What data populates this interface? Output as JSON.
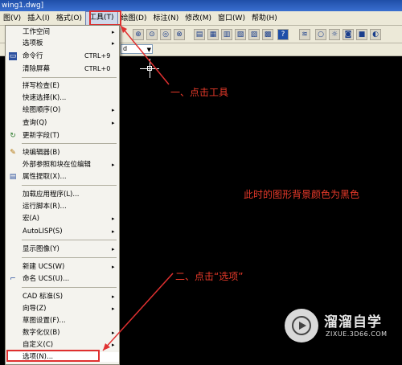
{
  "window": {
    "title": "wing1.dwg]"
  },
  "menubar": {
    "items": [
      "图(V)",
      "插入(I)",
      "格式(O)",
      "工具(T)",
      "绘图(D)",
      "标注(N)",
      "修改(M)",
      "窗口(W)",
      "帮助(H)"
    ]
  },
  "toolbar": {
    "combo_value": "d",
    "help_glyph": "?"
  },
  "menu": {
    "items": [
      {
        "label": "工作空间",
        "arrow": "▸"
      },
      {
        "label": "选项板",
        "arrow": "▸"
      },
      {
        "label": "命令行",
        "shortcut": "CTRL+9"
      },
      {
        "label": "清除屏幕",
        "shortcut": "CTRL+0"
      },
      {
        "label": "拼写检查(E)"
      },
      {
        "label": "快速选择(K)..."
      },
      {
        "label": "绘图顺序(O)",
        "arrow": "▸"
      },
      {
        "label": "查询(Q)",
        "arrow": "▸"
      },
      {
        "label": "更新字段(T)"
      },
      {
        "label": "块编辑器(B)"
      },
      {
        "label": "外部参照和块在位编辑",
        "arrow": "▸"
      },
      {
        "label": "属性提取(X)..."
      },
      {
        "label": "加载应用程序(L)..."
      },
      {
        "label": "运行脚本(R)..."
      },
      {
        "label": "宏(A)",
        "arrow": "▸"
      },
      {
        "label": "AutoLISP(S)",
        "arrow": "▸"
      },
      {
        "label": "显示图像(Y)",
        "arrow": "▸"
      },
      {
        "label": "新建 UCS(W)",
        "arrow": "▸"
      },
      {
        "label": "命名 UCS(U)..."
      },
      {
        "label": "CAD 标准(S)",
        "arrow": "▸"
      },
      {
        "label": "向导(Z)",
        "arrow": "▸"
      },
      {
        "label": "草图设置(F)..."
      },
      {
        "label": "数字化仪(B)",
        "arrow": "▸"
      },
      {
        "label": "自定义(C)",
        "arrow": "▸"
      },
      {
        "label": "选项(N)..."
      }
    ]
  },
  "annotations": {
    "step1": "一、点击工具",
    "step2": "二、点击“选项”",
    "note": "此时的图形背景颜色为黑色"
  },
  "watermark": {
    "brand": "溜溜自学",
    "site": "ZIXUE.3D66.COM"
  },
  "colors": {
    "annotation": "#e83a2a",
    "canvas": "#000000",
    "menu_bg": "#f4f3ee"
  }
}
